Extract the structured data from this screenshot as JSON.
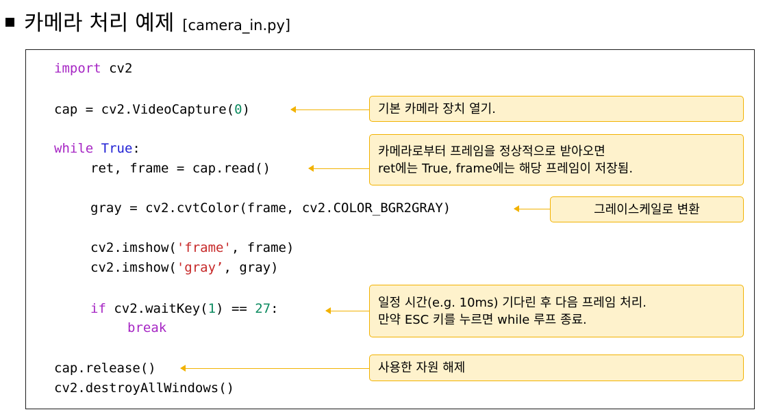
{
  "title": {
    "main": "카메라 처리 예제",
    "file": "[camera_in.py]"
  },
  "code": {
    "l1_kw": "import",
    "l1_rest": " cv2",
    "l2_a": "cap = cv2.VideoCapture(",
    "l2_num": "0",
    "l2_b": ")",
    "l3_kw": "while",
    "l3_sp": " ",
    "l3_true": "True",
    "l3_colon": ":",
    "l4": "ret, frame = cap.read()",
    "l5": "gray = cv2.cvtColor(frame, cv2.COLOR_BGR2GRAY)",
    "l6_a": "cv2.imshow(",
    "l6_str": "'frame'",
    "l6_b": ", frame)",
    "l7_a": "cv2.imshow(",
    "l7_str": "'gray’",
    "l7_b": ", gray)",
    "l8_kw": "if",
    "l8_a": " cv2.waitKey(",
    "l8_num1": "1",
    "l8_b": ") == ",
    "l8_num2": "27",
    "l8_c": ":",
    "l9_kw": "break",
    "l10": "cap.release()",
    "l11": "cv2.destroyAllWindows()"
  },
  "callouts": {
    "camera_open": "기본 카메라 장치 열기.",
    "read_line1": "카메라로부터 프레임을 정상적으로 받아오면",
    "read_line2": "ret에는 True, frame에는 해당 프레임이 저장됨.",
    "grayscale": "그레이스케일로 변환",
    "wait_line1": "일정 시간(e.g. 10ms) 기다린 후 다음 프레임 처리.",
    "wait_line2": "만약 ESC 키를 누르면 while 루프 종료.",
    "release": "사용한 자원 해제"
  },
  "colors": {
    "callout_fill": "#fef2cc",
    "callout_border": "#f2b200",
    "keyword": "#a626c4",
    "builtin": "#1f1fd4",
    "number": "#0b8a5f",
    "string": "#c62828"
  }
}
